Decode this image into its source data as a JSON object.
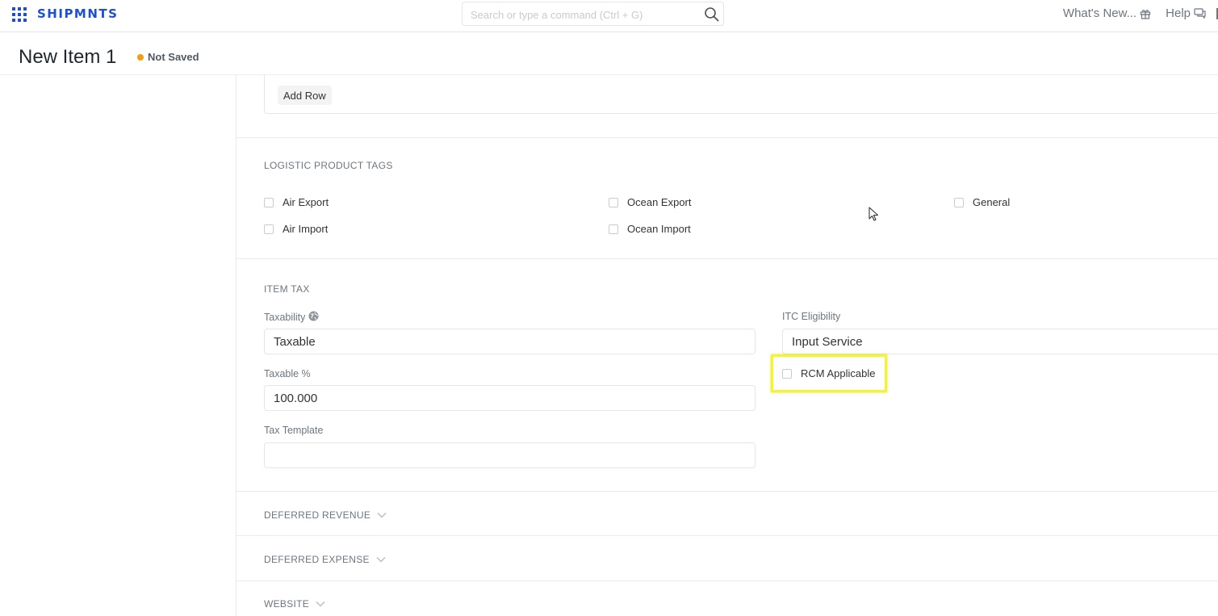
{
  "navbar": {
    "brand": "SHIPMNTS",
    "search_placeholder": "Search or type a command (Ctrl + G)",
    "whats_new": "What's New...",
    "help": "Help"
  },
  "page": {
    "title": "New Item 1",
    "status": "Not Saved",
    "status_color": "#f59e0b"
  },
  "table": {
    "add_row_label": "Add Row"
  },
  "logistic_tags": {
    "title": "LOGISTIC PRODUCT TAGS",
    "items": [
      {
        "label": "Air Export",
        "checked": false
      },
      {
        "label": "Air Import",
        "checked": false
      },
      {
        "label": "Ocean Export",
        "checked": false
      },
      {
        "label": "Ocean Import",
        "checked": false
      },
      {
        "label": "General",
        "checked": false
      }
    ]
  },
  "item_tax": {
    "title": "ITEM TAX",
    "taxability_label": "Taxability",
    "taxability_value": "Taxable",
    "taxable_pct_label": "Taxable %",
    "taxable_pct_value": "100.000",
    "tax_template_label": "Tax Template",
    "tax_template_value": "",
    "itc_label": "ITC Eligibility",
    "itc_value": "Input Service",
    "rcm_label": "RCM Applicable",
    "rcm_checked": false
  },
  "collapsed_sections": {
    "deferred_revenue": "DEFERRED REVENUE",
    "deferred_expense": "DEFERRED EXPENSE",
    "website": "WEBSITE"
  },
  "colors": {
    "brand": "#1d4ed8",
    "highlight": "#f5f52a"
  }
}
